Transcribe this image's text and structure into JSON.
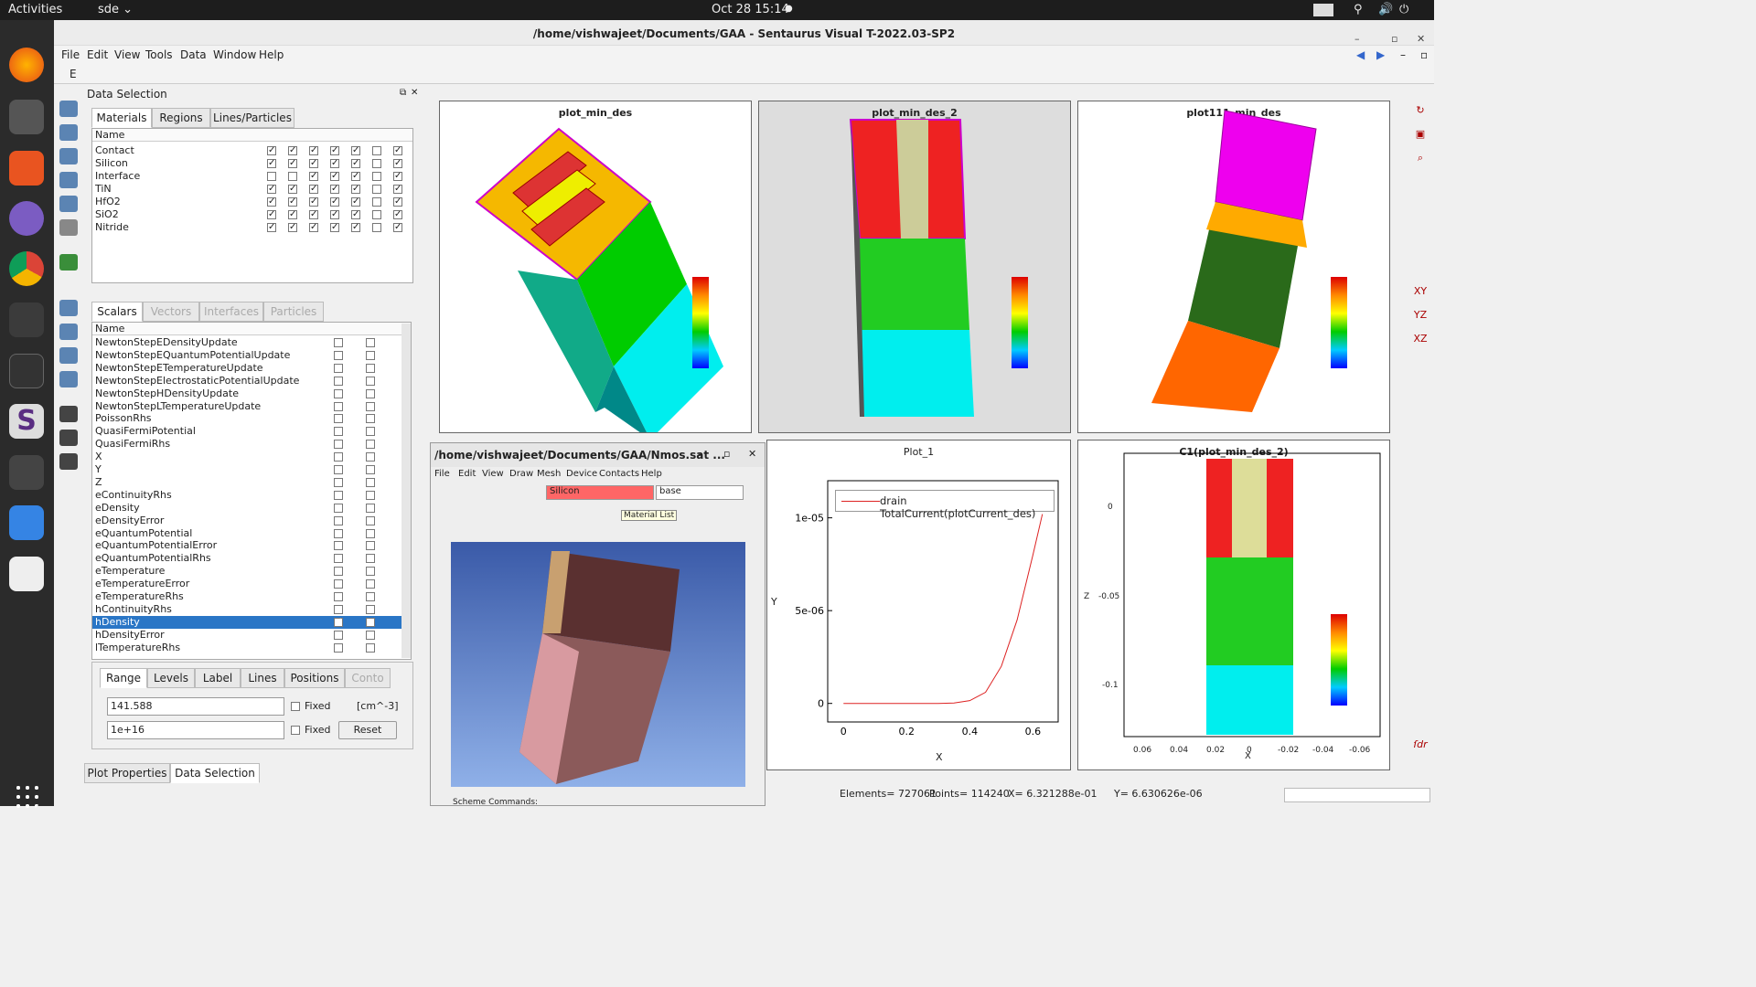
{
  "topbar": {
    "activities": "Activities",
    "app": "sde ⌄",
    "datetime": "Oct 28  15:14",
    "dot": "●"
  },
  "window": {
    "title": "/home/vishwajeet/Documents/GAA - Sentaurus Visual T-2022.03-SP2"
  },
  "menu": [
    "File",
    "Edit",
    "View",
    "Tools",
    "Data",
    "Window",
    "Help"
  ],
  "toolbar2": {
    "label": "E"
  },
  "datasel": {
    "title": "Data Selection",
    "tabs": [
      "Materials",
      "Regions",
      "Lines/Particles"
    ],
    "name_header": "Name",
    "materials": [
      {
        "name": "Contact",
        "checks": [
          1,
          1,
          1,
          1,
          1,
          0,
          1
        ]
      },
      {
        "name": "Silicon",
        "checks": [
          1,
          1,
          1,
          1,
          1,
          0,
          1
        ]
      },
      {
        "name": "Interface",
        "checks": [
          0,
          0,
          1,
          1,
          1,
          0,
          1
        ]
      },
      {
        "name": "TiN",
        "checks": [
          1,
          1,
          1,
          1,
          1,
          0,
          1
        ]
      },
      {
        "name": "HfO2",
        "checks": [
          1,
          1,
          1,
          1,
          1,
          0,
          1
        ]
      },
      {
        "name": "SiO2",
        "checks": [
          1,
          1,
          1,
          1,
          1,
          0,
          1
        ]
      },
      {
        "name": "Nitride",
        "checks": [
          1,
          1,
          1,
          1,
          1,
          0,
          1
        ]
      }
    ],
    "scalar_tabs": [
      "Scalars",
      "Vectors",
      "Interfaces",
      "Particles"
    ],
    "scalars": [
      "NewtonStepEDensityUpdate",
      "NewtonStepEQuantumPotentialUpdate",
      "NewtonStepETemperatureUpdate",
      "NewtonStepElectrostaticPotentialUpdate",
      "NewtonStepHDensityUpdate",
      "NewtonStepLTemperatureUpdate",
      "PoissonRhs",
      "QuasiFermiPotential",
      "QuasiFermiRhs",
      "X",
      "Y",
      "Z",
      "eContinuityRhs",
      "eDensity",
      "eDensityError",
      "eQuantumPotential",
      "eQuantumPotentialError",
      "eQuantumPotentialRhs",
      "eTemperature",
      "eTemperatureError",
      "eTemperatureRhs",
      "hContinuityRhs",
      "hDensity",
      "hDensityError",
      "lTemperatureRhs"
    ],
    "selected_scalar": "hDensity",
    "range_tabs": [
      "Range",
      "Levels",
      "Label",
      "Lines",
      "Positions",
      "Conto"
    ],
    "min_value": "141.588",
    "max_value": "1e+16",
    "fixed": "Fixed",
    "unit": "[cm^-3]",
    "reset": "Reset",
    "bottom_tabs": [
      "Plot Properties",
      "Data Selection"
    ]
  },
  "plots": {
    "p1": "plot_min_des",
    "p2": "plot_min_des_2",
    "p3": "plot111_min_des",
    "p4": "Plot_1",
    "p5": "C1(plot_min_des_2)"
  },
  "plot1": {
    "legend": "drain TotalCurrent(plotCurrent_des)",
    "xlabel": "X",
    "ylabel": "Y",
    "yticks": [
      "1e-05",
      "5e-06",
      "0"
    ],
    "xticks": [
      "0",
      "0.2",
      "0.4",
      "0.6"
    ]
  },
  "plot5": {
    "xlabel": "X",
    "ylabel": "Z",
    "yticks": [
      "0",
      "-0.05",
      "-0.1"
    ],
    "xticks": [
      "0.06",
      "0.04",
      "0.02",
      "0",
      "-0.02",
      "-0.04",
      "-0.06"
    ]
  },
  "nmos": {
    "title": "/home/vishwajeet/Documents/GAA/Nmos.sat ...",
    "menu": [
      "File",
      "Edit",
      "View",
      "Draw",
      "Mesh",
      "Device",
      "Contacts",
      "Help"
    ],
    "material": "Silicon",
    "region": "base",
    "tooltip": "Material List",
    "scheme": "Scheme Commands:"
  },
  "status": {
    "elements": "Elements= 727061",
    "points": "Points= 114240",
    "x": "X= 6.321288e-01",
    "y": "Y= 6.630626e-06"
  },
  "chart_data": {
    "type": "line",
    "title": "Plot_1",
    "xlabel": "X",
    "ylabel": "Y",
    "xlim": [
      -0.05,
      0.68
    ],
    "ylim": [
      -1e-06,
      1.2e-05
    ],
    "series": [
      {
        "name": "drain TotalCurrent(plotCurrent_des)",
        "x": [
          0,
          0.1,
          0.2,
          0.3,
          0.35,
          0.4,
          0.45,
          0.5,
          0.55,
          0.6,
          0.63
        ],
        "y": [
          0,
          0,
          0,
          0,
          2e-08,
          1.5e-07,
          6e-07,
          2e-06,
          4.5e-06,
          8e-06,
          1.02e-05
        ]
      }
    ],
    "color": "#d22"
  }
}
